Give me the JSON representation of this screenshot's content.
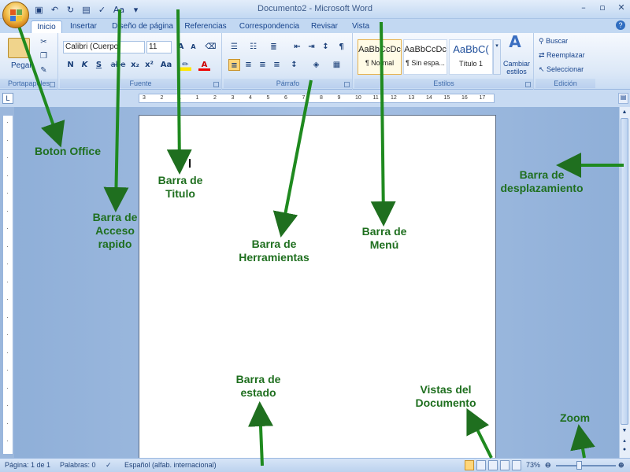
{
  "window": {
    "title": "Documento2 - Microsoft Word",
    "help": "?"
  },
  "quick_access": {
    "icons": [
      "save-icon",
      "undo-icon",
      "redo-icon",
      "print-preview-icon",
      "spelling-icon",
      "font-size-icon"
    ],
    "font_glyph": "Aa"
  },
  "tabs": [
    "Inicio",
    "Insertar",
    "Diseño de página",
    "Referencias",
    "Correspondencia",
    "Revisar",
    "Vista"
  ],
  "ribbon": {
    "clipboard": {
      "label": "Portapapeles",
      "paste": "Pegar"
    },
    "font": {
      "label": "Fuente",
      "name": "Calibri (Cuerpo)",
      "size": "11",
      "bold": "N",
      "italic": "K",
      "underline": "S",
      "strike": "abe",
      "subscript": "x₂",
      "superscript": "x²",
      "case": "Aa"
    },
    "paragraph": {
      "label": "Párrafo"
    },
    "styles": {
      "label": "Estilos",
      "items": [
        {
          "preview": "AaBbCcDc",
          "name": "¶ Normal"
        },
        {
          "preview": "AaBbCcDc",
          "name": "¶ Sin espa..."
        },
        {
          "preview": "AaBbC(",
          "name": "Título 1"
        }
      ],
      "change": "Cambiar estilos"
    },
    "editing": {
      "label": "Edición",
      "find": "Buscar",
      "replace": "Reemplazar",
      "select": "Seleccionar"
    }
  },
  "ruler": {
    "tab_selector": "L",
    "h_numbers": [
      3,
      2,
      1,
      1,
      2,
      3,
      4,
      5,
      6,
      7,
      8,
      9,
      10,
      11,
      12,
      13,
      14,
      15,
      16,
      17
    ]
  },
  "status": {
    "page": "Página: 1 de 1",
    "words": "Palabras: 0",
    "language": "Español (alfab. internacional)",
    "zoom": "73%"
  },
  "annotations": {
    "office": "Boton Office",
    "quick": "Barra de\nAcceso\nrapido",
    "title": "Barra de\nTitulo",
    "toolbar": "Barra de\nHerramientas",
    "menu": "Barra de\nMenú",
    "scroll": "Barra de\ndesplazamiento",
    "status": "Barra de\nestado",
    "views": "Vistas del\nDocumento",
    "zoom": "Zoom"
  },
  "colors": {
    "accent": "#15428b",
    "annotation": "#1f6f1f",
    "frame": "#c2d8f2"
  }
}
